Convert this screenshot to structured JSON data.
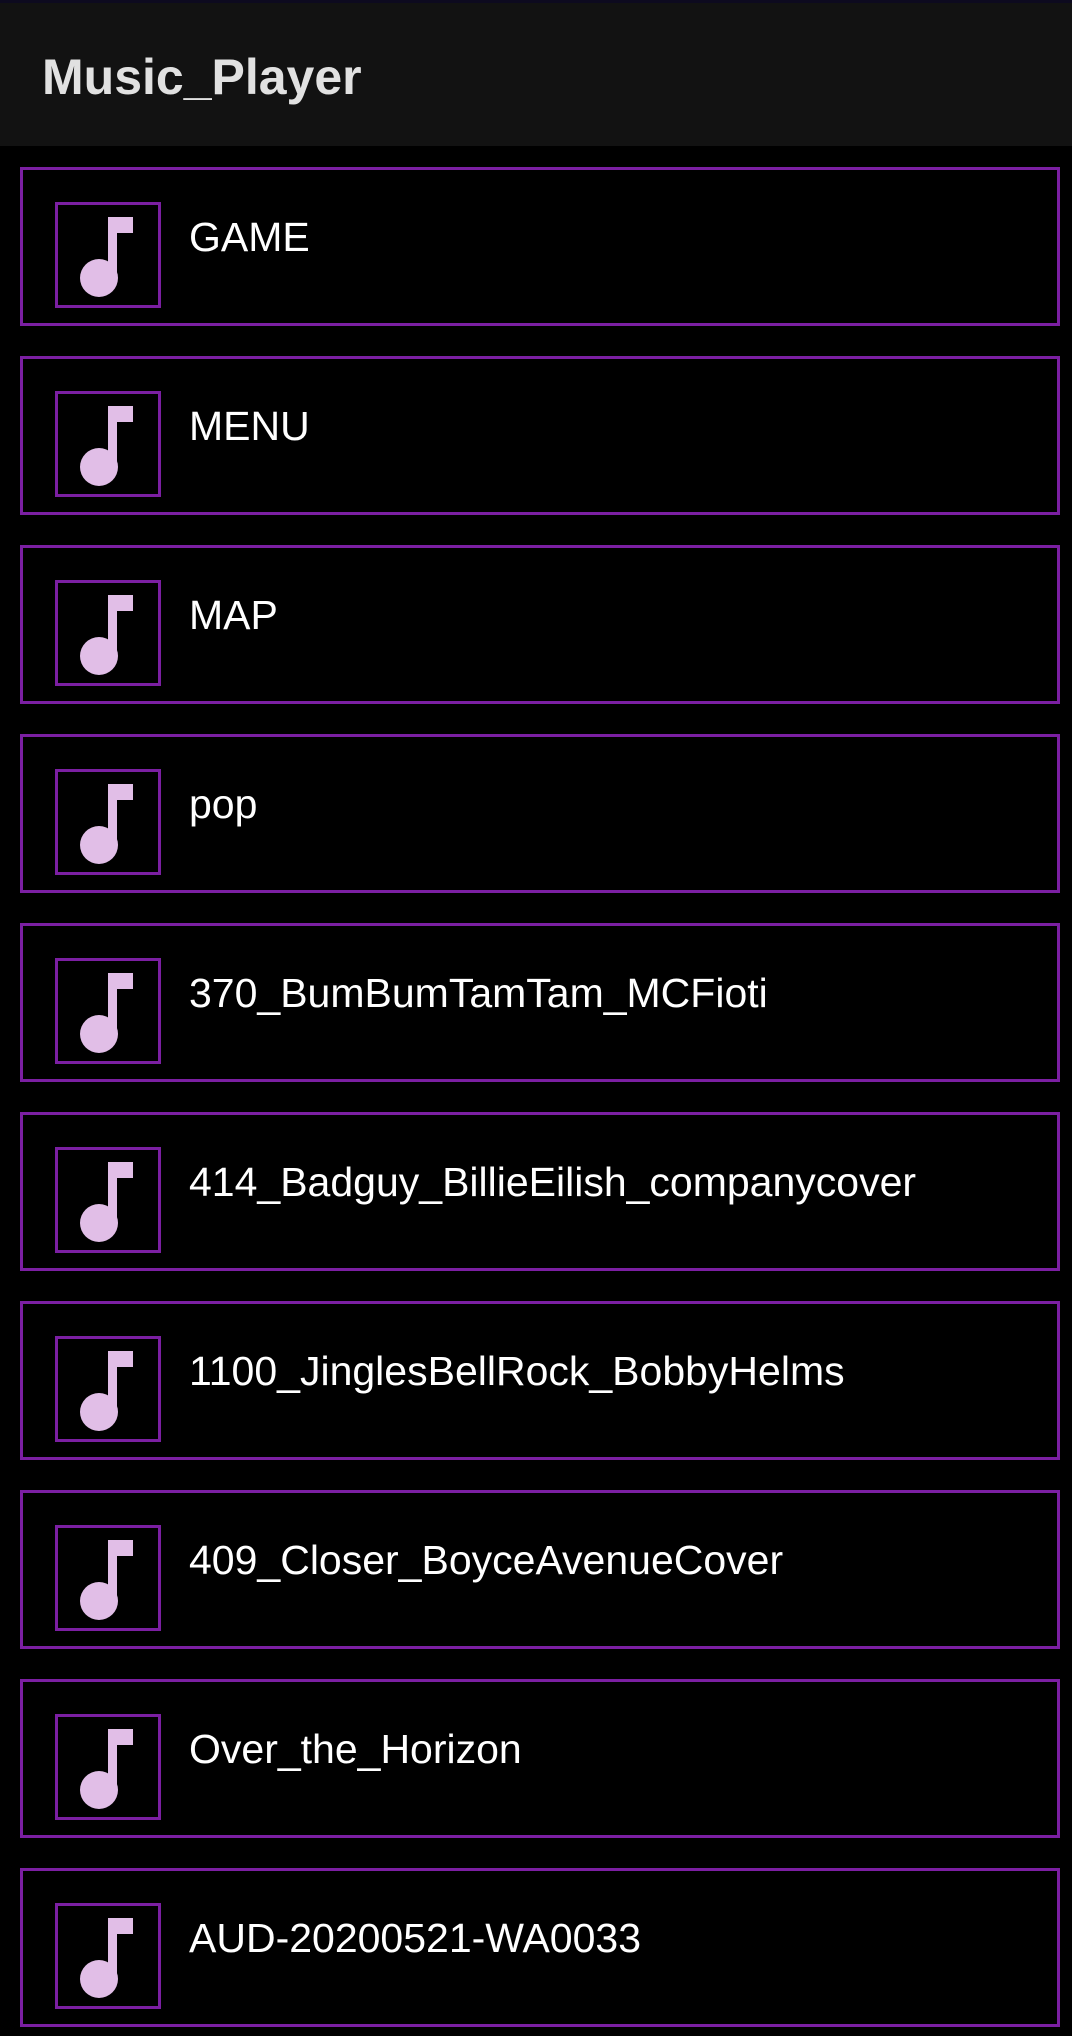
{
  "app_bar": {
    "title": "Music_Player"
  },
  "songs": [
    {
      "title": "GAME",
      "icon": "music-note-icon"
    },
    {
      "title": "MENU",
      "icon": "music-note-icon"
    },
    {
      "title": "MAP",
      "icon": "music-note-icon"
    },
    {
      "title": "pop",
      "icon": "music-note-icon"
    },
    {
      "title": "370_BumBumTamTam_MCFioti",
      "icon": "music-note-icon"
    },
    {
      "title": "414_Badguy_BillieEilish_companycover",
      "icon": "music-note-icon"
    },
    {
      "title": "1100_JinglesBellRock_BobbyHelms",
      "icon": "music-note-icon"
    },
    {
      "title": "409_Closer_BoyceAvenueCover",
      "icon": "music-note-icon"
    },
    {
      "title": "Over_the_Horizon",
      "icon": "music-note-icon"
    },
    {
      "title": "AUD-20200521-WA0033",
      "icon": "music-note-icon"
    }
  ],
  "colors": {
    "background": "#000000",
    "app_bar": "#121212",
    "accent_border": "#7b1fa2",
    "note_fill": "#e1bee7",
    "title_text": "#e1e1e1",
    "item_text": "#ffffff"
  }
}
